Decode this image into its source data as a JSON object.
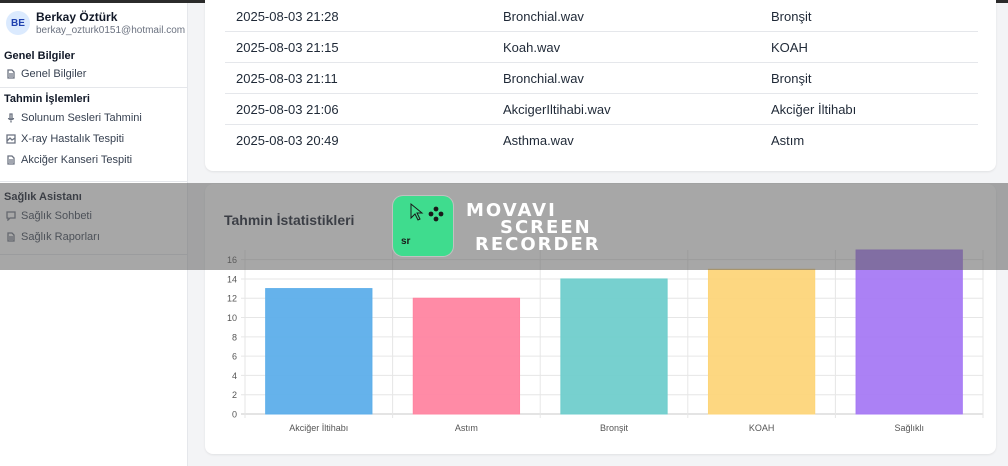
{
  "user": {
    "initials": "BE",
    "name": "Berkay Öztürk",
    "email": "berkay_ozturk0151@hotmail.com"
  },
  "sidebar": {
    "sections": [
      {
        "title": "Genel Bilgiler",
        "items": [
          {
            "label": "Genel Bilgiler",
            "icon": "document-icon"
          }
        ]
      },
      {
        "title": "Tahmin İşlemleri",
        "items": [
          {
            "label": "Solunum Sesleri Tahmini",
            "icon": "microphone-icon"
          },
          {
            "label": "X-ray Hastalık Tespiti",
            "icon": "image-icon"
          },
          {
            "label": "Akciğer Kanseri Tespiti",
            "icon": "document-icon"
          }
        ]
      },
      {
        "title": "Sağlık Asistanı",
        "items": [
          {
            "label": "Sağlık Sohbeti",
            "icon": "chat-icon"
          },
          {
            "label": "Sağlık Raporları",
            "icon": "document-icon"
          }
        ]
      }
    ]
  },
  "history": {
    "rows": [
      {
        "date": "2025-08-03 21:28",
        "file": "Bronchial.wav",
        "result": "Bronşit"
      },
      {
        "date": "2025-08-03 21:15",
        "file": "Koah.wav",
        "result": "KOAH"
      },
      {
        "date": "2025-08-03 21:11",
        "file": "Bronchial.wav",
        "result": "Bronşit"
      },
      {
        "date": "2025-08-03 21:06",
        "file": "AkcigerIltihabi.wav",
        "result": "Akciğer İltihabı"
      },
      {
        "date": "2025-08-03 20:49",
        "file": "Asthma.wav",
        "result": "Astım"
      }
    ]
  },
  "stats": {
    "title": "Tahmin İstatistikleri"
  },
  "chart_data": {
    "type": "bar",
    "categories": [
      "Akciğer İltihabı",
      "Astım",
      "Bronşit",
      "KOAH",
      "Sağlıklı"
    ],
    "values": [
      13,
      12,
      14,
      15,
      17
    ],
    "colors": [
      "#5daeea",
      "#ff85a1",
      "#70cecc",
      "#fdd57a",
      "#a77af4"
    ],
    "ylim": [
      0,
      17
    ],
    "yticks": [
      "0",
      "2",
      "4",
      "6",
      "8",
      "10",
      "12",
      "14",
      "16"
    ],
    "grid": true
  },
  "watermark": {
    "logo_text": "sr",
    "line1": "MOVAVI",
    "line2": "SCREEN",
    "line3": "RECORDER"
  }
}
